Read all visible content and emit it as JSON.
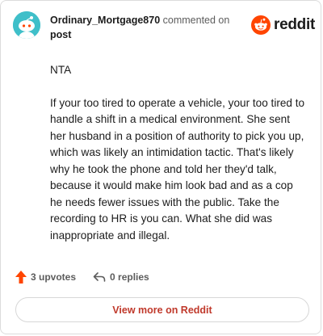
{
  "header": {
    "username": "Ordinary_Mortgage870",
    "action_text": "commented on",
    "target_link": "post",
    "avatar_icon": "snoo-avatar-icon",
    "brand_logo_icon": "reddit-logo-icon",
    "brand_name": "reddit"
  },
  "comment": {
    "paragraphs": [
      "NTA",
      "If your too tired to operate a vehicle, your too tired to handle a shift in a medical environment. She sent her husband in a position of authority to pick you up, which was likely an intimidation tactic. That's likely why he took the phone and told her they'd talk, because it would make him look bad and as a cop he needs fewer issues with the public. Take the recording to HR is you can. What she did was inappropriate and illegal."
    ]
  },
  "footer": {
    "upvote_icon": "upvote-arrow-icon",
    "upvotes_label": "3 upvotes",
    "reply_icon": "reply-arrow-icon",
    "replies_label": "0 replies"
  },
  "view_more_label": "View more on Reddit",
  "colors": {
    "avatar_bg": "#3fbfc9",
    "upvote": "#ff4500",
    "brand": "#ff4500",
    "link": "#c0392b"
  }
}
